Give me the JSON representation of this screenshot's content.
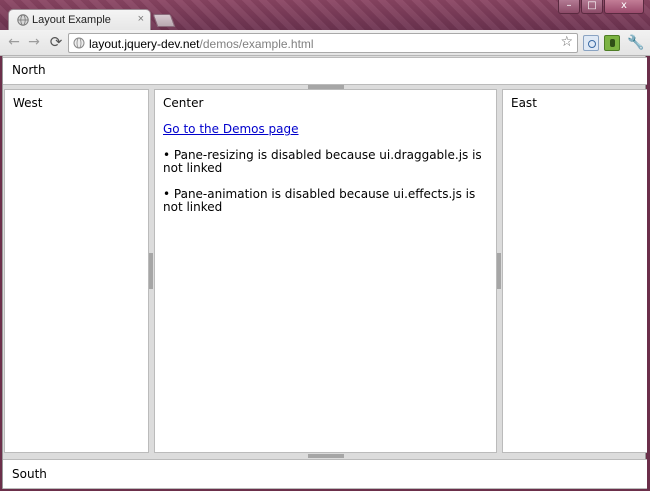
{
  "browser": {
    "tab_title": "Layout Example",
    "tab_close": "×",
    "url_host": "layout.jquery-dev.net",
    "url_path": "/demos/example.html",
    "window_buttons": [
      "–",
      "□",
      "x"
    ],
    "nav": {
      "back": "←",
      "forward": "→",
      "reload": "⟳",
      "star": "☆",
      "wrench": "🔧"
    },
    "theme_color": "#7a3a57"
  },
  "layout": {
    "north": "North",
    "south": "South",
    "west": "West",
    "east": "East",
    "center": {
      "title": "Center",
      "link": "Go to the Demos page",
      "notes": [
        "• Pane-resizing is disabled because ui.draggable.js is not linked",
        "• Pane-animation is disabled because ui.effects.js is not linked"
      ]
    }
  }
}
